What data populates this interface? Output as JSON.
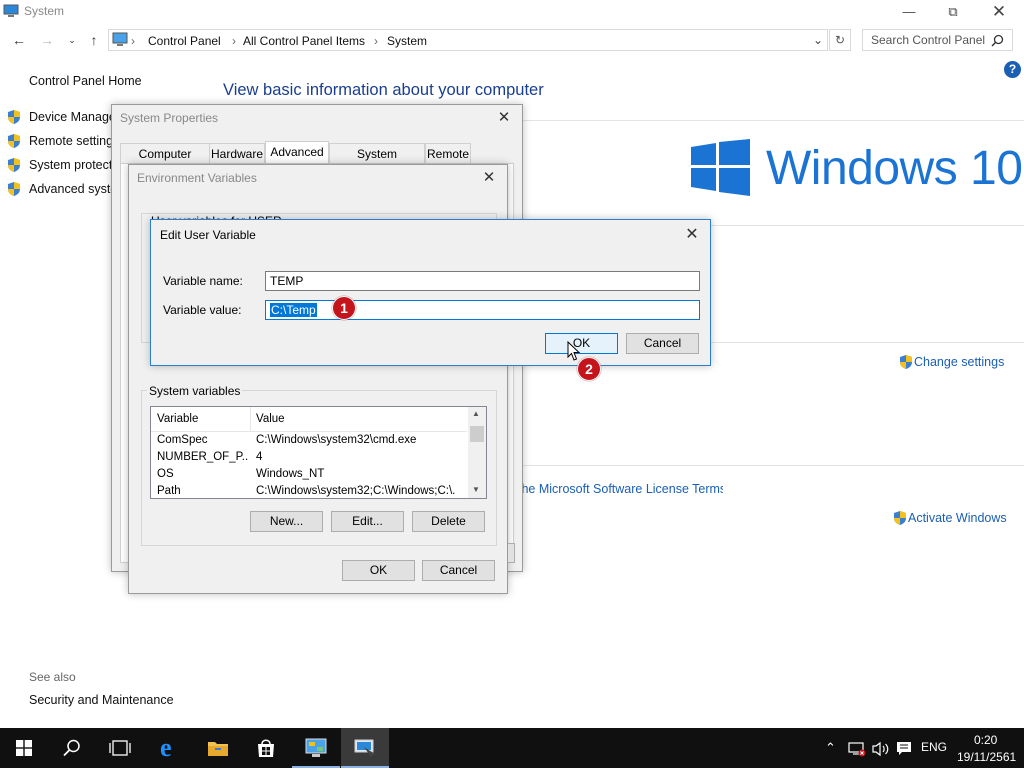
{
  "window": {
    "title": "System"
  },
  "address": {
    "crumbs": [
      "Control Panel",
      "All Control Panel Items",
      "System"
    ],
    "search_placeholder": "Search Control Panel"
  },
  "left_panel": {
    "home": "Control Panel Home",
    "links": [
      "Device Manager",
      "Remote settings",
      "System protection",
      "Advanced system settings"
    ],
    "see_also": "See also",
    "security": "Security and Maintenance"
  },
  "main": {
    "heading": "View basic information about your computer",
    "brand": "Windows 10",
    "change_settings": "Change settings",
    "license_link": "the Microsoft Software License Terms",
    "activate": "Activate Windows"
  },
  "system_properties": {
    "title": "System Properties",
    "tabs": [
      "Computer Name",
      "Hardware",
      "Advanced",
      "System Protection",
      "Remote"
    ],
    "active_tab": "Advanced"
  },
  "env_vars": {
    "title": "Environment Variables",
    "user_vars_label": "User variables for USER",
    "system_vars_label": "System variables",
    "columns": [
      "Variable",
      "Value"
    ],
    "rows": [
      {
        "name": "ComSpec",
        "value": "C:\\Windows\\system32\\cmd.exe"
      },
      {
        "name": "NUMBER_OF_P...",
        "value": "4"
      },
      {
        "name": "OS",
        "value": "Windows_NT"
      },
      {
        "name": "Path",
        "value": "C:\\Windows\\system32;C:\\Windows;C:\\..."
      }
    ],
    "buttons": {
      "new": "New...",
      "edit": "Edit...",
      "delete": "Delete",
      "ok": "OK",
      "cancel": "Cancel"
    }
  },
  "edit_dialog": {
    "title": "Edit User Variable",
    "name_label": "Variable name:",
    "name_value": "TEMP",
    "value_label": "Variable value:",
    "value_value": "C:\\Temp",
    "ok": "OK",
    "cancel": "Cancel"
  },
  "markers": [
    "1",
    "2"
  ],
  "taskbar": {
    "lang": "ENG",
    "time": "0:20",
    "date": "19/11/2561"
  },
  "colors": {
    "accent": "#0078d7",
    "windows_blue": "#1b74d4",
    "link": "#1a5fb4",
    "marker": "#c4141c"
  }
}
